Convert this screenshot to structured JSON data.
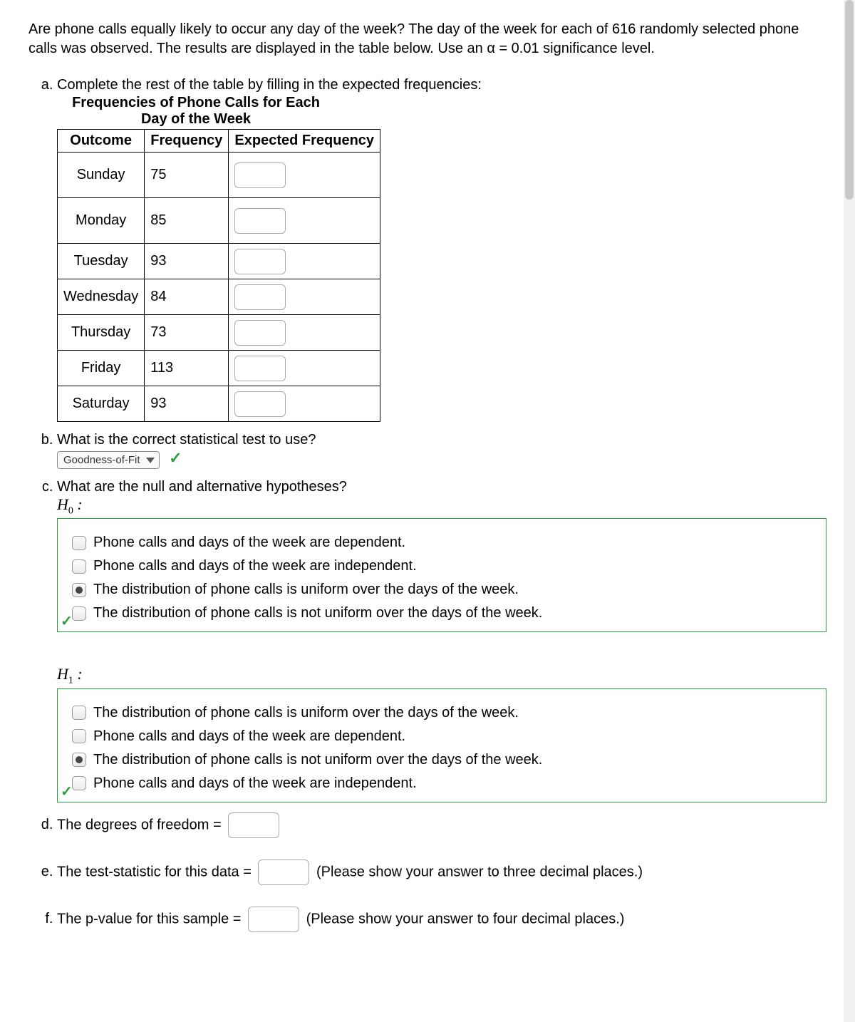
{
  "intro": "Are phone calls equally likely to occur any day of the week? The day of the week for each of 616 randomly selected phone calls was observed. The results are displayed in the table below.  Use an α = 0.01 significance level.",
  "a": {
    "prompt": "Complete the rest of the table by filling in the expected frequencies:",
    "title": "Frequencies of Phone Calls for Each Day of the Week",
    "headers": {
      "c1": "Outcome",
      "c2": "Frequency",
      "c3": "Expected Frequency"
    },
    "rows": [
      {
        "day": "Sunday",
        "freq": "75"
      },
      {
        "day": "Monday",
        "freq": "85"
      },
      {
        "day": "Tuesday",
        "freq": "93"
      },
      {
        "day": "Wednesday",
        "freq": "84"
      },
      {
        "day": "Thursday",
        "freq": "73"
      },
      {
        "day": "Friday",
        "freq": "113"
      },
      {
        "day": "Saturday",
        "freq": "93"
      }
    ]
  },
  "b": {
    "prompt": "What is the correct statistical test to use?",
    "selected": "Goodness-of-Fit"
  },
  "c": {
    "prompt": "What are the null and alternative hypotheses?",
    "h0_label": "H",
    "h0_options": [
      {
        "text": "Phone calls and days of the week are dependent.",
        "selected": false
      },
      {
        "text": "Phone calls and days of the week are independent.",
        "selected": false
      },
      {
        "text": "The distribution of phone calls is uniform over the days of the week.",
        "selected": true
      },
      {
        "text": "The distribution of phone calls is not uniform over the days of the week.",
        "selected": false
      }
    ],
    "h1_options": [
      {
        "text": "The distribution of phone calls is uniform over the days of the week.",
        "selected": false
      },
      {
        "text": "Phone calls and days of the week are dependent.",
        "selected": false
      },
      {
        "text": "The distribution of phone calls is not uniform over the days of the week.",
        "selected": true
      },
      {
        "text": "Phone calls and days of the week are independent.",
        "selected": false
      }
    ]
  },
  "d": {
    "prompt": "The degrees of freedom ="
  },
  "e": {
    "prompt": "The test-statistic for this data =",
    "hint": "(Please show your answer to three decimal places.)"
  },
  "f": {
    "prompt": "The p-value for this sample =",
    "hint": "(Please show your answer to four decimal places.)"
  }
}
